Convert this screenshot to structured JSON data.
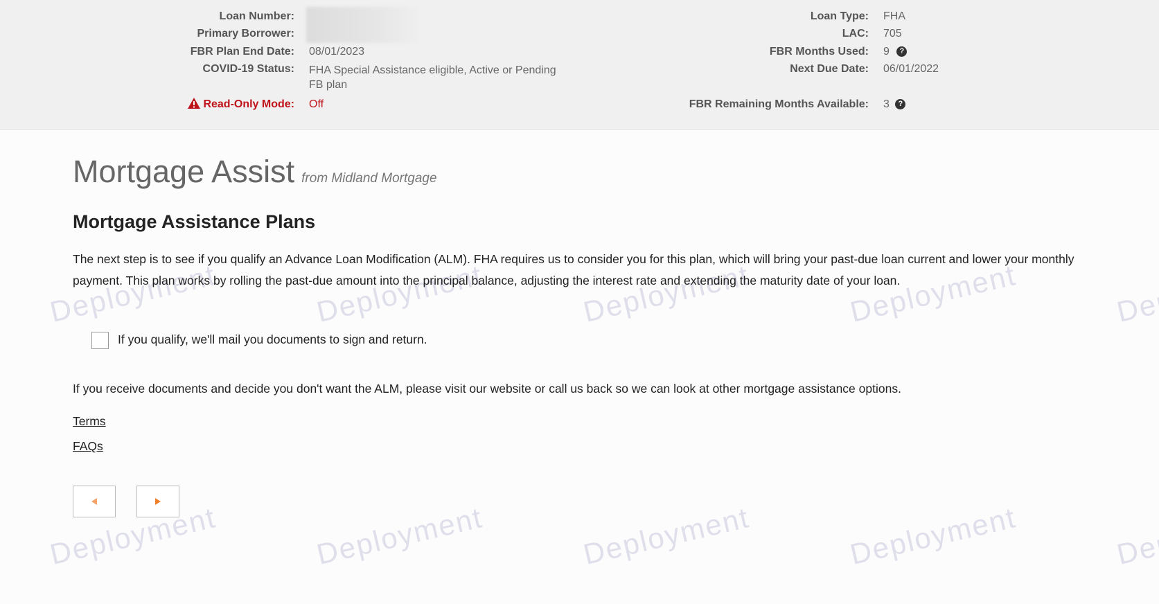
{
  "header": {
    "left": [
      {
        "label": "Loan Number:",
        "value": ""
      },
      {
        "label": "Primary Borrower:",
        "value": ""
      },
      {
        "label": "FBR Plan End Date:",
        "value": "08/01/2023"
      },
      {
        "label": "COVID-19 Status:",
        "value": "FHA Special Assistance eligible, Active or Pending FB plan"
      },
      {
        "label": "Read-Only Mode:",
        "value": "Off"
      }
    ],
    "right": [
      {
        "label": "Loan Type:",
        "value": "FHA"
      },
      {
        "label": "LAC:",
        "value": "705"
      },
      {
        "label": "FBR Months Used:",
        "value": "9"
      },
      {
        "label": "Next Due Date:",
        "value": "06/01/2022"
      },
      {
        "label": "FBR Remaining Months Available:",
        "value": "3"
      }
    ],
    "help_icon_glyph": "?",
    "warning_icon": "warning-triangle-icon",
    "alert_color": "#c0141b"
  },
  "main": {
    "title": "Mortgage Assist",
    "subtitle": "from Midland Mortgage",
    "heading": "Mortgage Assistance Plans",
    "paragraph1": "The next step is to see if you qualify an Advance Loan Modification (ALM). FHA requires us to consider you for this plan, which will bring your past-due loan current and lower your monthly payment. This plan works by rolling the past-due amount into the principal balance, adjusting the interest rate and extending the maturity date of your loan.",
    "checkbox_label": "If you qualify, we'll mail you documents to sign and return.",
    "paragraph2": "If you receive documents and decide you don't want the ALM, please visit our website or call us back so we can look at other mortgage assistance options.",
    "links": {
      "terms": "Terms",
      "faqs": "FAQs"
    },
    "nav": {
      "prev_icon": "triangle-left-icon",
      "next_icon": "triangle-right-icon",
      "accent": "#f07f2a"
    }
  },
  "watermark": "Deployment"
}
